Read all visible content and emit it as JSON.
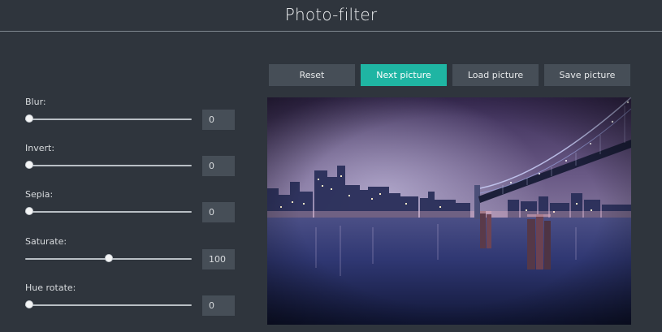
{
  "header": {
    "title": "Photo-filter"
  },
  "toolbar": {
    "reset_label": "Reset",
    "next_label": "Next picture",
    "load_label": "Load picture",
    "save_label": "Save picture",
    "accent_color": "#1fb5a3"
  },
  "filters": [
    {
      "label": "Blur:",
      "value": "0",
      "level": 0
    },
    {
      "label": "Invert:",
      "value": "0",
      "level": 0
    },
    {
      "label": "Sepia:",
      "value": "0",
      "level": 0
    },
    {
      "label": "Saturate:",
      "value": "100",
      "level": 0.5
    },
    {
      "label": "Hue rotate:",
      "value": "0",
      "level": 0
    }
  ],
  "photo": {
    "subject": "night city skyline with suspension bridge over river"
  }
}
